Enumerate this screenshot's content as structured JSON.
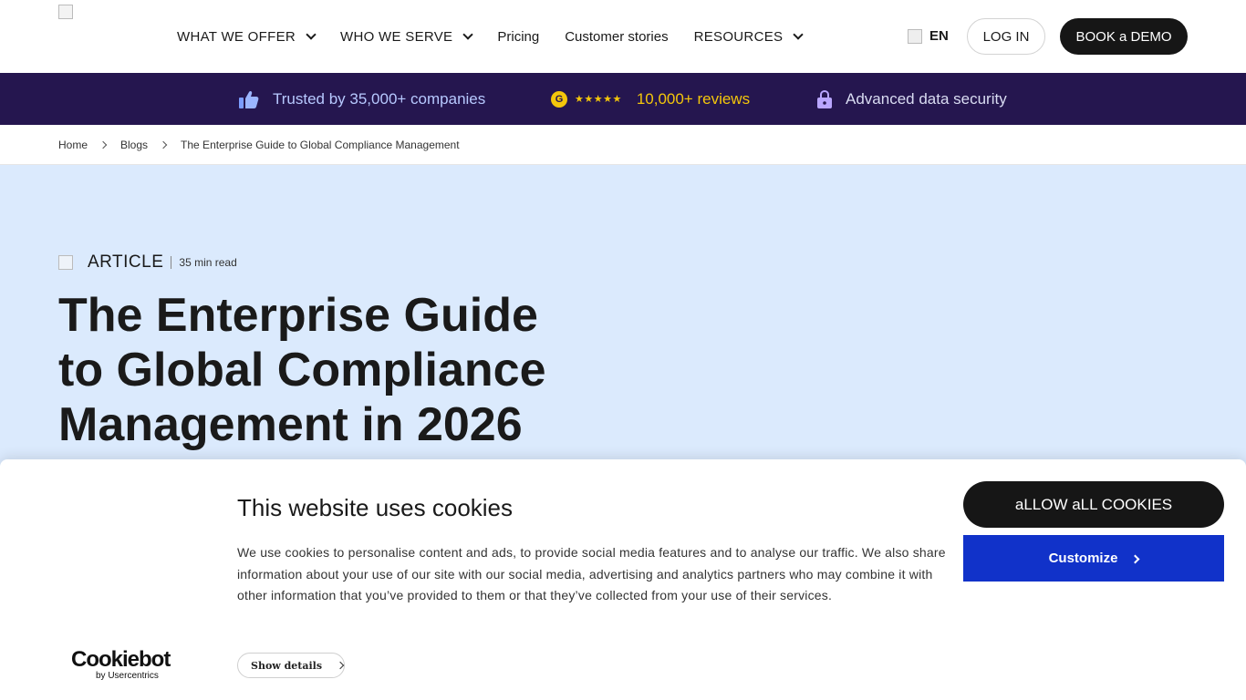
{
  "nav": {
    "menu": [
      {
        "label": "WHAT WE OFFER",
        "dropdown": true
      },
      {
        "label": "WHO WE SERVE",
        "dropdown": true
      },
      {
        "label": "Pricing",
        "dropdown": false
      },
      {
        "label": "Customer stories",
        "dropdown": false
      },
      {
        "label": "RESOURCES",
        "dropdown": true
      }
    ],
    "language": "EN",
    "login_label": "LOG IN",
    "demo_label": "BOOK a DEMO"
  },
  "trust_bar": {
    "companies": "Trusted by 35,000+ companies",
    "g2_letter": "G",
    "stars": "★★★★★",
    "reviews": "10,000+ reviews",
    "security": "Advanced data security",
    "background": "#25164f"
  },
  "breadcrumb": {
    "home": "Home",
    "blogs": "Blogs",
    "current": "The Enterprise Guide to Global Compliance Management"
  },
  "article": {
    "type": "ARTICLE",
    "read_time": "35 min read",
    "title": "The Enterprise Guide to Global Compliance Management in 2026",
    "hero_background": "#dbeafd"
  },
  "cookie_banner": {
    "title": "This website uses cookies",
    "text": "We use cookies to personalise content and ads, to provide social media features and to analyse our traffic. We also share information about your use of our site with our social media, advertising and analytics partners who may combine it with other information that you’ve provided to them or that they’ve collected from your use of their services.",
    "logo_main": "Cookiebot",
    "logo_sub": "by Usercentrics",
    "show_details": "Show details",
    "allow_all": "aLLOW aLL COOKIES",
    "customize": "Customize",
    "customize_color": "#1132c9"
  }
}
